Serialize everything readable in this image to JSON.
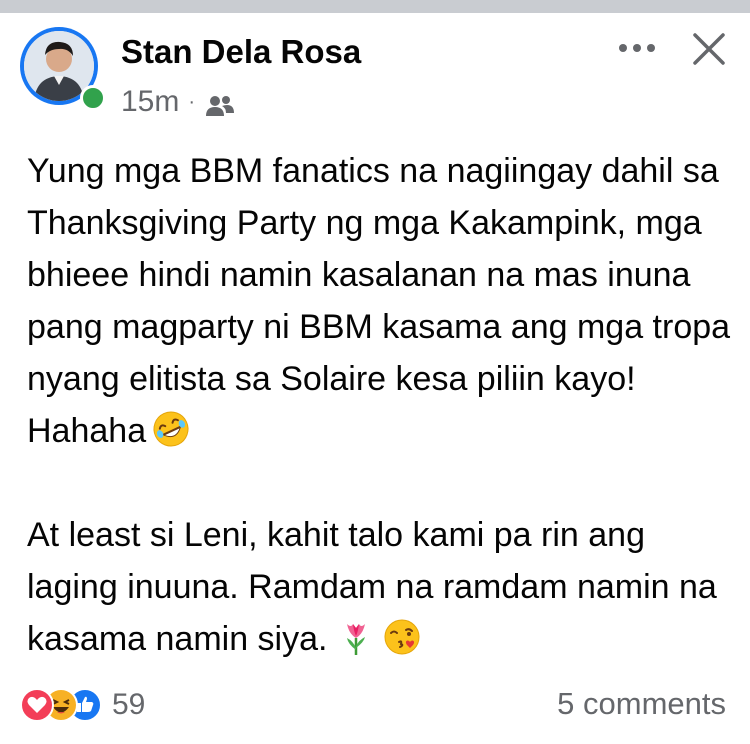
{
  "post": {
    "author_name": "Stan Dela Rosa",
    "time": "15m",
    "separator": "·",
    "audience_icon": "friends-icon",
    "body_para1": "Yung mga BBM fanatics na nagiingay dahil sa Thanksgiving Party ng mga Kakampink, mga bhieee hindi namin kasalanan na mas inuna pang magparty ni BBM kasama ang mga tropa nyang elitista sa Solaire kesa piliin kayo! Hahaha",
    "body_para2": "At least si Leni, kahit talo kami pa rin ang laging inuuna. Ramdam na ramdam namin na kasama namin siya.",
    "para1_emoji": "rolling-on-floor-laughing-emoji",
    "para2_emojis": [
      "tulip-emoji",
      "face-blowing-kiss-emoji"
    ],
    "online": true
  },
  "footer": {
    "reaction_count": "59",
    "reaction_icons": [
      "love-reaction-icon",
      "haha-reaction-icon",
      "like-reaction-icon"
    ],
    "comments_label": "5 comments"
  },
  "colors": {
    "accent": "#1877f2",
    "online": "#31a24c",
    "secondary_text": "#65676b",
    "love": "#f33e58",
    "haha": "#f7b125",
    "like": "#1877f2"
  }
}
